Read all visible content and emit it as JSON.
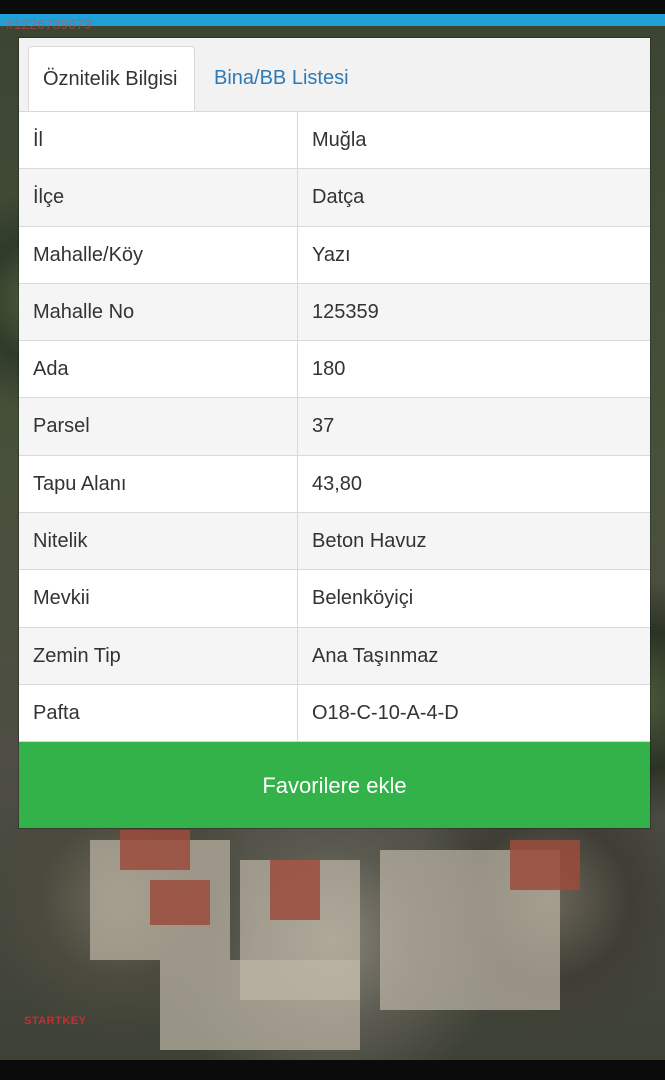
{
  "watermark": {
    "id_text": "#1226739679",
    "brand_text": "STARTKEY"
  },
  "tabs": [
    {
      "label": "Öznitelik Bilgisi",
      "active": true
    },
    {
      "label": "Bina/BB Listesi",
      "active": false
    }
  ],
  "attributes": [
    {
      "key": "İl",
      "value": "Muğla"
    },
    {
      "key": "İlçe",
      "value": "Datça"
    },
    {
      "key": "Mahalle/Köy",
      "value": "Yazı"
    },
    {
      "key": "Mahalle No",
      "value": "125359"
    },
    {
      "key": "Ada",
      "value": "180"
    },
    {
      "key": "Parsel",
      "value": "37"
    },
    {
      "key": "Tapu Alanı",
      "value": "43,80"
    },
    {
      "key": "Nitelik",
      "value": "Beton Havuz"
    },
    {
      "key": "Mevkii",
      "value": "Belenköyiçi"
    },
    {
      "key": "Zemin Tip",
      "value": "Ana Taşınmaz"
    },
    {
      "key": "Pafta",
      "value": "O18-C-10-A-4-D"
    }
  ],
  "actions": {
    "favorite_label": "Favorilere ekle"
  },
  "colors": {
    "accent_line": "#1fa0d6",
    "button_green": "#33b24a",
    "tab_link_blue": "#2f7ab5"
  }
}
